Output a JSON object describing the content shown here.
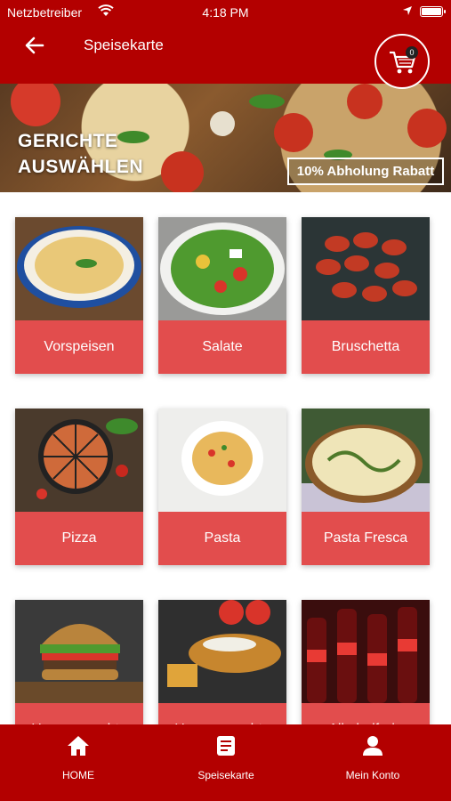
{
  "status_bar": {
    "carrier": "Netzbetreiber",
    "time": "4:18 PM"
  },
  "header": {
    "title": "Speisekarte",
    "cart_count": "0"
  },
  "hero": {
    "heading": "GERICHTE\nAUSWÄHLEN",
    "promo": "10% Abholung Rabatt"
  },
  "categories": [
    {
      "label": "Vorspeisen"
    },
    {
      "label": "Salate"
    },
    {
      "label": "Bruschetta"
    },
    {
      "label": "Pizza"
    },
    {
      "label": "Pasta"
    },
    {
      "label": "Pasta Fresca"
    },
    {
      "label": "Hausgemachte"
    },
    {
      "label": "Hausgemachte"
    },
    {
      "label": "Alkoholfreie"
    }
  ],
  "nav": {
    "home": "HOME",
    "menu": "Speisekarte",
    "account": "Mein Konto"
  },
  "colors": {
    "primary": "#b30000",
    "card_label": "#e24d4d"
  }
}
